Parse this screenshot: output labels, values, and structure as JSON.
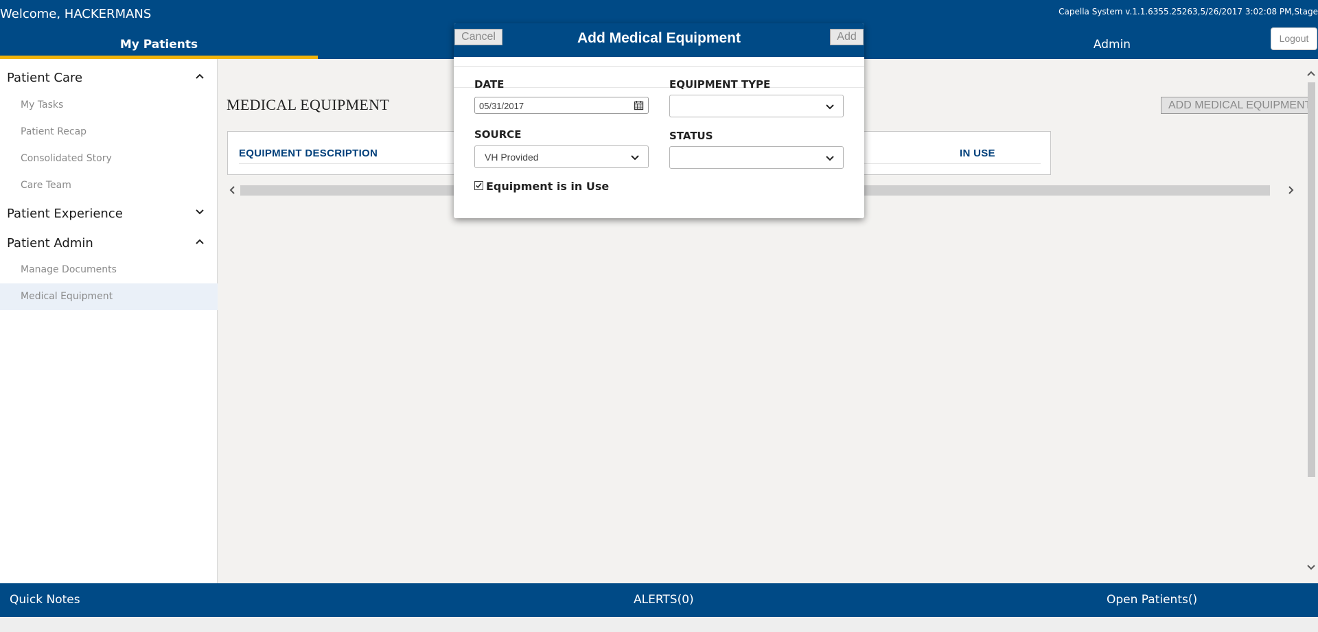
{
  "header": {
    "welcome": "Welcome, HACKERMANS",
    "system_info": "Capella System v.1.1.6355.25263,5/26/2017 3:02:08 PM,Stage",
    "nav_my_patients": "My Patients",
    "nav_admin": "Admin",
    "logout_label": "Logout",
    "accent_color": "#f2b40b",
    "brand_color": "#004a86"
  },
  "sidebar": {
    "sections": [
      {
        "title": "Patient Care",
        "expanded": true,
        "items": [
          "My Tasks",
          "Patient Recap",
          "Consolidated Story",
          "Care Team"
        ]
      },
      {
        "title": "Patient Experience",
        "expanded": false,
        "items": []
      },
      {
        "title": "Patient Admin",
        "expanded": true,
        "items": [
          "Manage Documents",
          "Medical Equipment"
        ]
      }
    ],
    "active_item": "Medical Equipment"
  },
  "main": {
    "title": "MEDICAL EQUIPMENT",
    "add_button": "ADD MEDICAL EQUIPMENT",
    "columns": [
      "EQUIPMENT DESCRIPTION",
      "IN USE"
    ]
  },
  "modal": {
    "title": "Add Medical Equipment",
    "cancel_label": "Cancel",
    "add_label": "Add",
    "date_label": "DATE",
    "date_value": "05/31/2017",
    "equipment_type_label": "EQUIPMENT TYPE",
    "equipment_type_value": "",
    "source_label": "SOURCE",
    "source_value": "VH Provided",
    "status_label": "STATUS",
    "status_value": "",
    "in_use_label": "Equipment is in Use",
    "in_use_checked": true
  },
  "footer": {
    "quick_notes": "Quick Notes",
    "alerts": "ALERTS(0)",
    "open_patients": "Open Patients()"
  }
}
